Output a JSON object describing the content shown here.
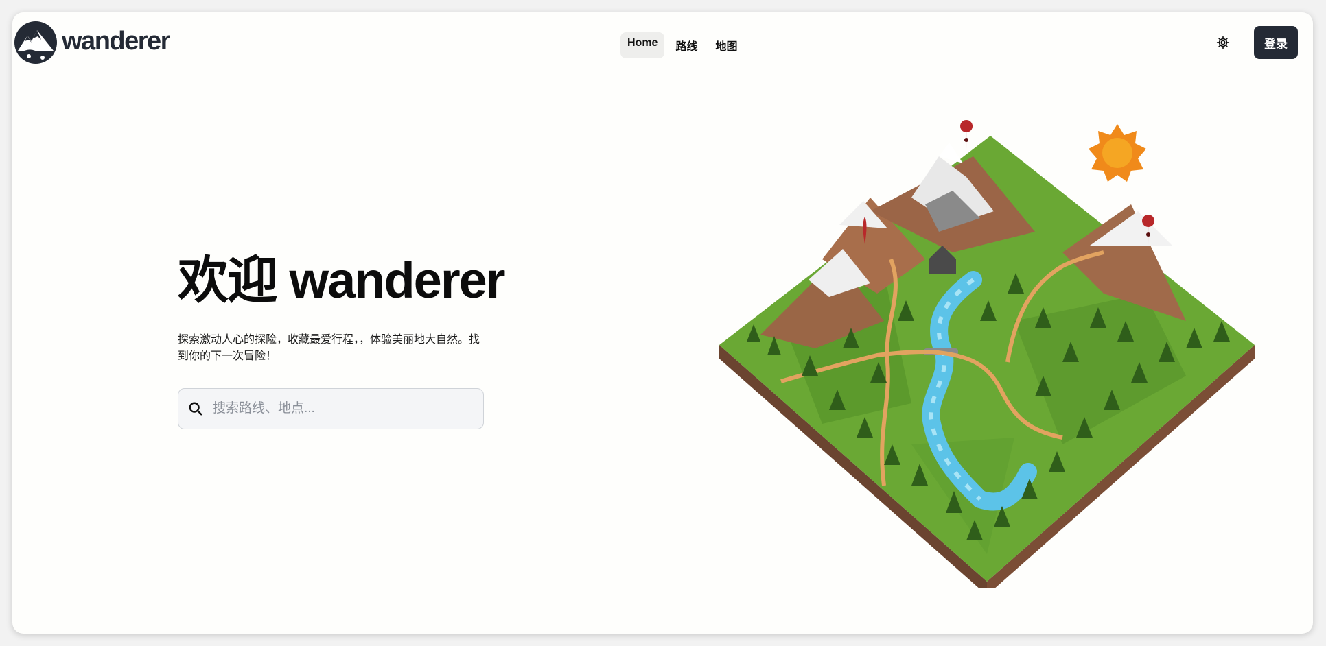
{
  "brand": {
    "name": "wanderer"
  },
  "nav": {
    "items": [
      "Home",
      "路线",
      "地图"
    ],
    "active": "Home"
  },
  "header": {
    "settings_icon": "gear-icon",
    "login_label": "登录"
  },
  "hero": {
    "title": "欢迎 wanderer",
    "subtitle": "探索激动人心的探险，收藏最爱行程，，体验美丽地大自然。找到你的下一次冒险！",
    "search_placeholder": "搜索路线、地点...",
    "search_value": ""
  },
  "colors": {
    "dark": "#242a35",
    "background": "#fefefc",
    "accent_pin": "#b8282a"
  }
}
